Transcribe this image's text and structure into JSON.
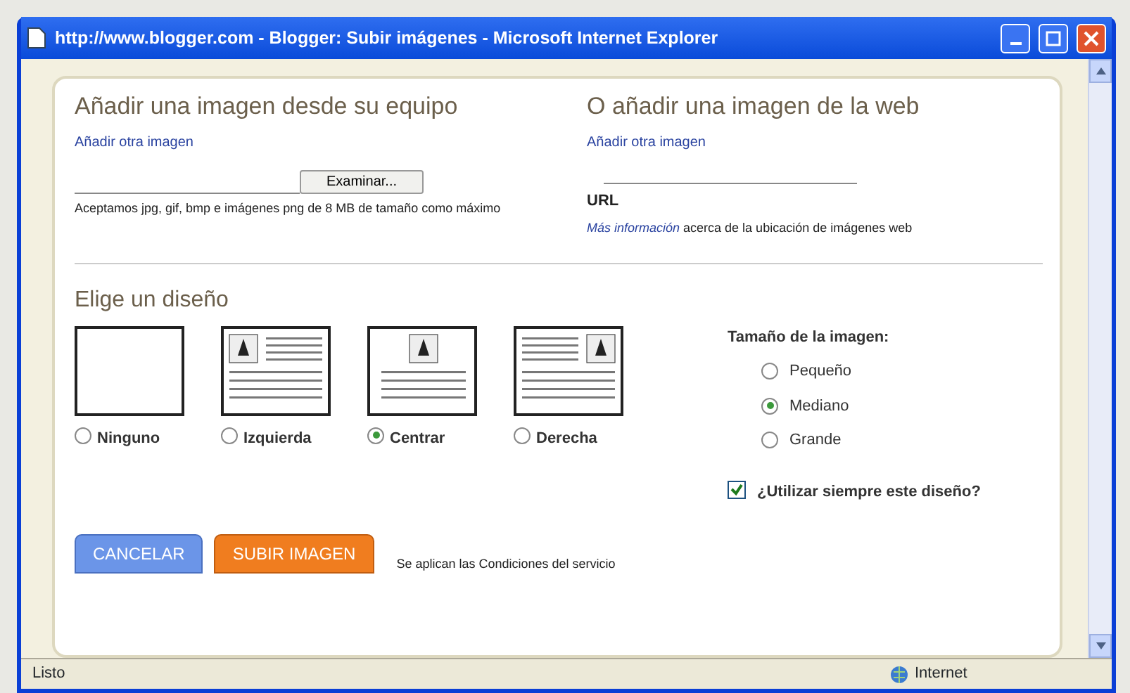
{
  "window": {
    "title": "http://www.blogger.com - Blogger: Subir imágenes - Microsoft Internet Explorer"
  },
  "upload": {
    "heading": "Añadir una imagen desde su equipo",
    "add_link": "Añadir otra imagen",
    "browse_button": "Examinar...",
    "note": "Aceptamos jpg, gif, bmp e imágenes png de 8 MB de tamaño como máximo"
  },
  "web": {
    "heading": "O añadir una imagen de la web",
    "add_link": "Añadir otra imagen",
    "url_label": "URL",
    "info_link": "Más información",
    "info_text": "acerca de la ubicación de imágenes web"
  },
  "layout": {
    "heading": "Elige un diseño",
    "options": [
      {
        "kind": "none",
        "label": "Ninguno",
        "selected": false
      },
      {
        "kind": "left",
        "label": "Izquierda",
        "selected": false
      },
      {
        "kind": "center",
        "label": "Centrar",
        "selected": true
      },
      {
        "kind": "right",
        "label": "Derecha",
        "selected": false
      }
    ]
  },
  "size": {
    "label": "Tamaño de la imagen:",
    "options": [
      {
        "label": "Pequeño",
        "selected": false
      },
      {
        "label": "Mediano",
        "selected": true
      },
      {
        "label": "Grande",
        "selected": false
      }
    ]
  },
  "remember": {
    "label": "¿Utilizar siempre este diseño?",
    "checked": true
  },
  "actions": {
    "cancel": "CANCELAR",
    "upload": "SUBIR IMAGEN",
    "note": "Se aplican las Condiciones del servicio"
  },
  "status_bar": {
    "text": "Listo",
    "zone": "Internet"
  }
}
